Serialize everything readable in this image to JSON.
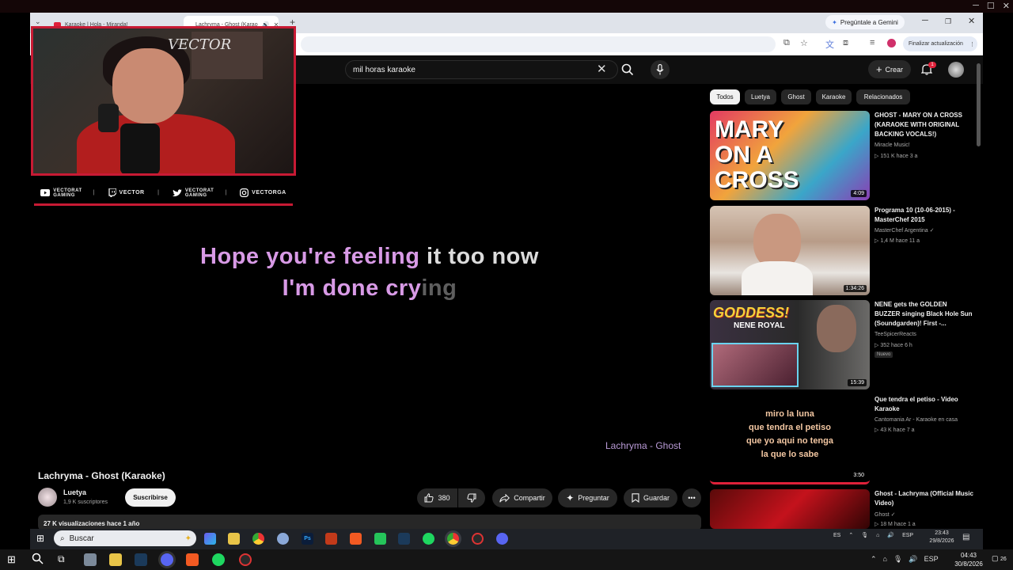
{
  "browser": {
    "tabs": [
      {
        "label": "Karaoke | Hola - Miranda!"
      },
      {
        "label": "Lachryma - Ghost (Karao"
      }
    ],
    "gemini_label": "Pregúntale a Gemini",
    "update_label": "Finalizar actualización",
    "webcam_watermark": "VECTOR"
  },
  "youtube": {
    "search_value": "mil horas karaoke",
    "create_label": "Crear",
    "notification_count": "1"
  },
  "overlay": {
    "socials": [
      {
        "label": "VECTORAT GAMING",
        "icon": "youtube-icon"
      },
      {
        "label": "VECTOR",
        "icon": "twitch-icon"
      },
      {
        "label": "VECTORAT GAMING",
        "icon": "twitter-icon"
      },
      {
        "label": "VECTORGA",
        "icon": "instagram-icon"
      }
    ]
  },
  "player": {
    "lyric_line1_sung": "Hope you're feeling",
    "lyric_line1_rest": "it too now",
    "lyric_line2_sung": "I'm done cry",
    "lyric_line2_rest": "ing",
    "caption": "Lachryma - Ghost"
  },
  "video": {
    "title": "Lachryma - Ghost (Karaoke)",
    "channel": "Luetya",
    "subscribers": "1,9 K suscriptores",
    "subscribe_label": "Suscribirse",
    "likes": "380",
    "share_label": "Compartir",
    "ask_label": "Preguntar",
    "save_label": "Guardar",
    "views_line": "27 K visualizaciones  hace 1 año"
  },
  "chips": [
    "Todos",
    "Luetya",
    "Ghost",
    "Karaoke",
    "Relacionados"
  ],
  "recommendations": [
    {
      "title": "GHOST - MARY ON A CROSS (KARAOKE WITH ORIGINAL BACKING VOCALS!)",
      "channel": "Miracle Music!",
      "meta": "▷ 151 K  hace 3 a",
      "duration": "4:09",
      "thumb_text": "MARY ON A CROSS"
    },
    {
      "title": "Programa 10 (10-06-2015) - MasterChef 2015",
      "channel": "MasterChef Argentina ✓",
      "meta": "▷ 1,4 M  hace 11 a",
      "duration": "1:34:26"
    },
    {
      "title": "NENE gets the GOLDEN BUZZER singing Black Hole Sun (Soundgarden)! First -...",
      "channel": "TeeSpicerReacts",
      "meta": "▷ 352  hace 6 h",
      "badge": "Nuevo",
      "duration": "15:39",
      "thumb_text": "GODDESS!",
      "thumb_sub": "NENE ROYAL"
    },
    {
      "title": "Que tendra el petiso - Video Karaoke",
      "channel": "Cantomania Ar - Karaoke en casa",
      "meta": "▷ 43 K  hace 7 a",
      "duration": "3:50",
      "thumb_lines": [
        "miro la luna",
        "que tendra el petiso",
        "que yo aqui no tenga",
        "la que lo sabe"
      ]
    },
    {
      "title": "Ghost - Lachryma (Official Music Video)",
      "channel": "Ghost ✓",
      "meta": "▷ 18 M  hace 1 a"
    }
  ],
  "inner_taskbar": {
    "search_label": "Buscar",
    "lang": "ES",
    "kb": "ESP",
    "time": "23:43",
    "date": "29/8/2026"
  },
  "outer_taskbar": {
    "kb": "ESP",
    "time": "04:43",
    "date": "30/8/2026",
    "notif": "26"
  }
}
